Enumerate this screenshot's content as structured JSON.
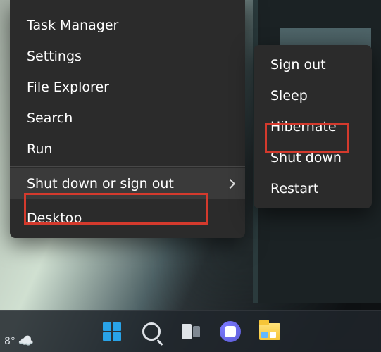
{
  "menu": {
    "items": [
      {
        "label": "Task Manager"
      },
      {
        "label": "Settings"
      },
      {
        "label": "File Explorer"
      },
      {
        "label": "Search"
      },
      {
        "label": "Run"
      },
      {
        "label": "Shut down or sign out",
        "hasSubmenu": true,
        "highlighted": true
      },
      {
        "label": "Desktop"
      }
    ]
  },
  "submenu": {
    "items": [
      {
        "label": "Sign out"
      },
      {
        "label": "Sleep"
      },
      {
        "label": "Hibernate",
        "highlighted": true
      },
      {
        "label": "Shut down"
      },
      {
        "label": "Restart"
      }
    ]
  },
  "taskbar": {
    "weather_temp": "8°"
  }
}
